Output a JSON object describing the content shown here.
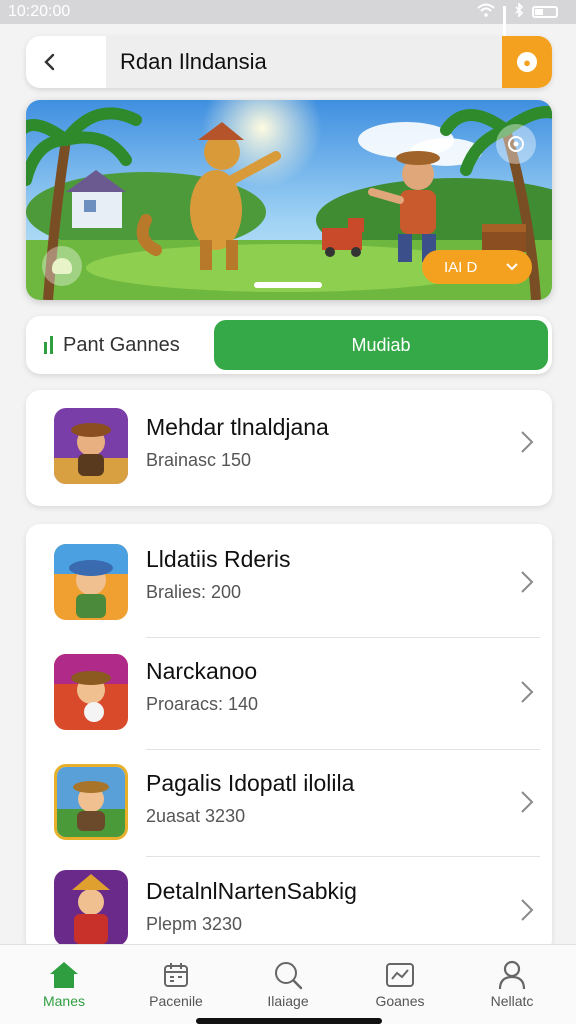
{
  "status_bar": {
    "time": "10:20:00"
  },
  "search": {
    "back_icon": "back-arrow-icon",
    "value": "Rdan Ilndansia",
    "action_icon": "coin-icon"
  },
  "banner": {
    "button_label": "IAI D",
    "button_icon": "chevron-down-icon"
  },
  "tabs": {
    "left_label": "Pant Gannes",
    "right_label": "Mudiab"
  },
  "featured": {
    "name": "Mehdar tlnaldjana",
    "subtitle": "Brainasc 150"
  },
  "games": [
    {
      "name": "Lldatiis Rderis",
      "subtitle": "Bralies: 200"
    },
    {
      "name": "Narckanoo",
      "subtitle": "Proaracs: 140"
    },
    {
      "name": "Pagalis Idopatl ilolila",
      "subtitle": "2uasat 3230"
    },
    {
      "name": "DetalnlNartenSabkig",
      "subtitle": "Plepm 3230"
    }
  ],
  "nav": [
    {
      "label": "Manes",
      "icon": "home-icon",
      "active": true
    },
    {
      "label": "Pacenile",
      "icon": "calendar-icon",
      "active": false
    },
    {
      "label": "Ilaiage",
      "icon": "search-icon",
      "active": false
    },
    {
      "label": "Goanes",
      "icon": "chart-icon",
      "active": false
    },
    {
      "label": "Nellatc",
      "icon": "profile-icon",
      "active": false
    }
  ],
  "colors": {
    "accent_green": "#35a847",
    "accent_orange": "#f4a11f"
  }
}
